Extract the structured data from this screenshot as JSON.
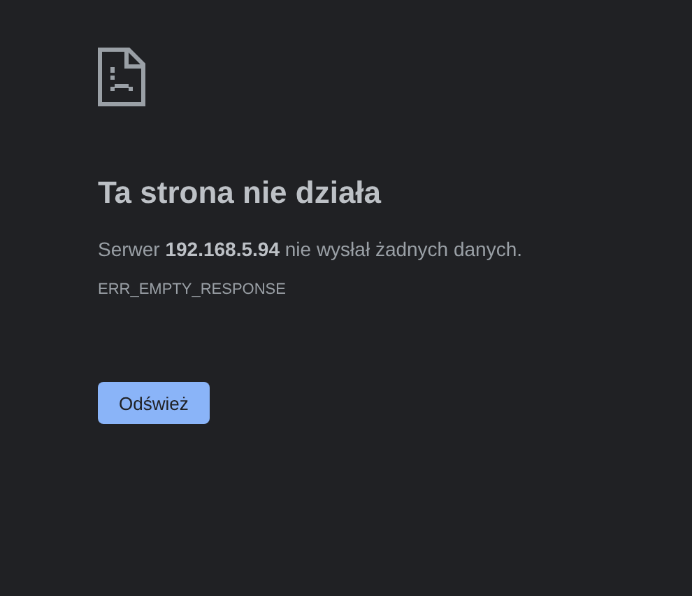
{
  "heading": "Ta strona nie działa",
  "message": "Serwer **192.168.5.94** nie wysłał żadnych danych.",
  "error_code": "ERR_EMPTY_RESPONSE",
  "buttons": [
    "Odśwież"
  ]
}
